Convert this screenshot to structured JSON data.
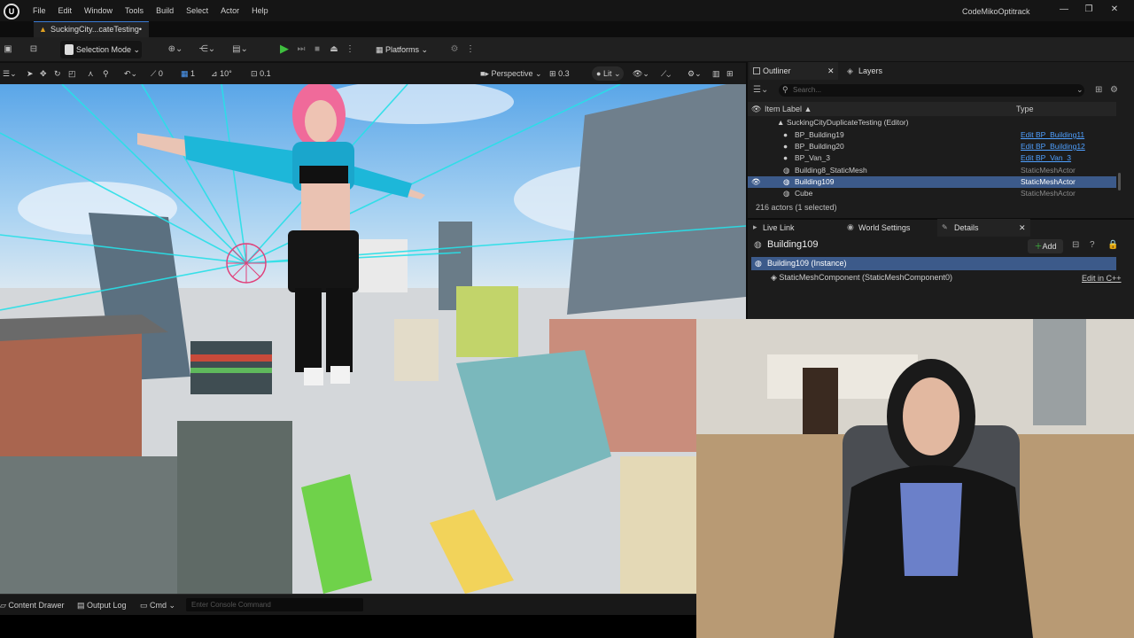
{
  "menu": [
    "File",
    "Edit",
    "Window",
    "Tools",
    "Build",
    "Select",
    "Actor",
    "Help"
  ],
  "app": {
    "logo": "U",
    "project": "CodeMikoOptitrack"
  },
  "window_controls": {
    "minimize": "—",
    "maximize": "❐",
    "close": "✕"
  },
  "level_tab": "SuckingCity...cateTesting•",
  "toolbar": {
    "selection_mode": "Selection Mode",
    "platforms": "Platforms"
  },
  "viewport_toolbar": {
    "grid_snap": "0",
    "grid_snap_value": "1",
    "rot_snap": "10°",
    "scale_snap": "0.1",
    "view_mode": "Perspective",
    "camera_speed": "0.3",
    "lit": "Lit"
  },
  "outliner": {
    "tab": "Outliner",
    "layers_tab": "Layers",
    "search_placeholder": "Search...",
    "col_label": "Item Label ▲",
    "col_type": "Type",
    "rows": [
      {
        "label": "SuckingCityDuplicateTesting (Editor)",
        "type": ""
      },
      {
        "label": "BP_Building19",
        "type": "Edit BP_Building11"
      },
      {
        "label": "BP_Building20",
        "type": "Edit BP_Building12"
      },
      {
        "label": "BP_Van_3",
        "type": "Edit BP_Van_3"
      },
      {
        "label": "Building8_StaticMesh",
        "type": "StaticMeshActor"
      },
      {
        "label": "Building109",
        "type": "StaticMeshActor"
      },
      {
        "label": "Cube",
        "type": "StaticMeshActor"
      }
    ],
    "status": "216 actors (1 selected)"
  },
  "details": {
    "tabs": [
      "Live Link",
      "World Settings",
      "Details"
    ],
    "title": "Building109",
    "add": "Add",
    "instance": "Building109 (Instance)",
    "component": "StaticMeshComponent (StaticMeshComponent0)",
    "edit_cpp": "Edit in C++"
  },
  "bottom": {
    "content_drawer": "Content Drawer",
    "output_log": "Output Log",
    "cmd": "Cmd",
    "console_placeholder": "Enter Console Command"
  },
  "colors": {
    "accent": "#3a7bd5",
    "selected_row": "#3c5a8a",
    "play": "#3fbf3f",
    "link": "#4fa0ff",
    "gizmo": "#28e0e8"
  }
}
